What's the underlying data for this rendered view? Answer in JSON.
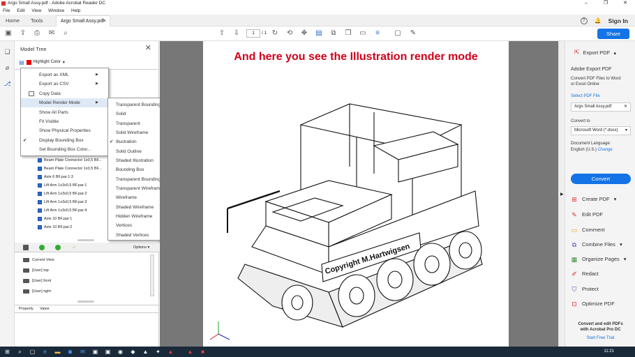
{
  "window": {
    "title": "Argo Small Assy.pdf - Adobe Acrobat Reader DC",
    "controls": [
      "–",
      "❐",
      "✕"
    ]
  },
  "menu": [
    "File",
    "Edit",
    "View",
    "Window",
    "Help"
  ],
  "tabs": {
    "home": "Home",
    "tools": "Tools",
    "doc": "Argo Small Assy.pdf",
    "close": "×"
  },
  "topright": {
    "help": "?",
    "sign_in": "Sign In"
  },
  "toolbar": {
    "page_current": "1",
    "page_total": "/ 1",
    "share": "Share"
  },
  "model_tree": {
    "title": "Model Tree",
    "close": "✕",
    "highlight_color": "Highlight Color",
    "tree_items": [
      "Beam Plate Connector 1x0,5 BF...",
      "Beam Plate Connector 1x0,5 BF...",
      "Axle 6 BF.par:1:3",
      "Lift Arm 1x3x0,5 BF.par:1",
      "Lift Arm 1x3x0,5 BF.par:2",
      "Lift Arm 1x3x0,5 BF.par:3",
      "Lift Arm 1x3x0,5 BF.par:4",
      "Axle 10 BF.par:1",
      "Axle 10 BF.par:2"
    ],
    "options": "Options",
    "views": [
      "Current View",
      "[User] top",
      "[User] front",
      "[User] right"
    ],
    "property_col": "Property",
    "value_col": "Value"
  },
  "context_menu": {
    "items": [
      {
        "label": "Export as XML",
        "submenu": true
      },
      {
        "label": "Export as CSV",
        "submenu": true
      },
      {
        "label": "Copy Data"
      },
      {
        "label": "Model Render Mode",
        "submenu": true,
        "highlighted": true
      },
      {
        "label": "Show All Parts"
      },
      {
        "label": "Fit Visible"
      },
      {
        "label": "Show Physical Properties"
      },
      {
        "label": "Display Bounding Box",
        "checked": true
      },
      {
        "label": "Set Bounding Box Color..."
      }
    ]
  },
  "render_submenu": {
    "items": [
      "Transparent Bounding Box",
      "Solid",
      "Transparent",
      "Solid Wireframe",
      "Illustration",
      "Solid Outline",
      "Shaded Illustration",
      "Bounding Box",
      "Transparent Bounding Box Outline",
      "Transparent Wireframe",
      "Wireframe",
      "Shaded Wireframe",
      "Hidden Wireframe",
      "Vertices",
      "Shaded Vertices"
    ],
    "checked_index": 4
  },
  "document": {
    "heading": "And here you see the Illustration render mode",
    "nameplate": "Copyright M.Hartwigsen",
    "colors": {
      "heading": "#d0021b"
    }
  },
  "right_pane": {
    "export_header": "Export PDF",
    "title": "Adobe Export PDF",
    "desc": [
      "Convert PDF Files to Word",
      "or Excel Online"
    ],
    "select_label": "Select PDF File",
    "file_value": "Argo Small Assy.pdf",
    "convert_to_label": "Convert to",
    "convert_to_value": "Microsoft Word (*.docx)",
    "doc_lang_label": "Document Language:",
    "doc_lang_value": "English (U.S.)",
    "change": "Change",
    "convert_button": "Convert",
    "tools": [
      "Create PDF",
      "Edit PDF",
      "Comment",
      "Combine Files",
      "Organize Pages",
      "Redact",
      "Protect",
      "Optimize PDF"
    ],
    "promo": [
      "Convert and edit PDFs",
      "with Acrobat Pro DC"
    ],
    "trial": "Start Free Trial",
    "accent": "#1473e6"
  },
  "taskbar": {
    "time": "11:21"
  }
}
